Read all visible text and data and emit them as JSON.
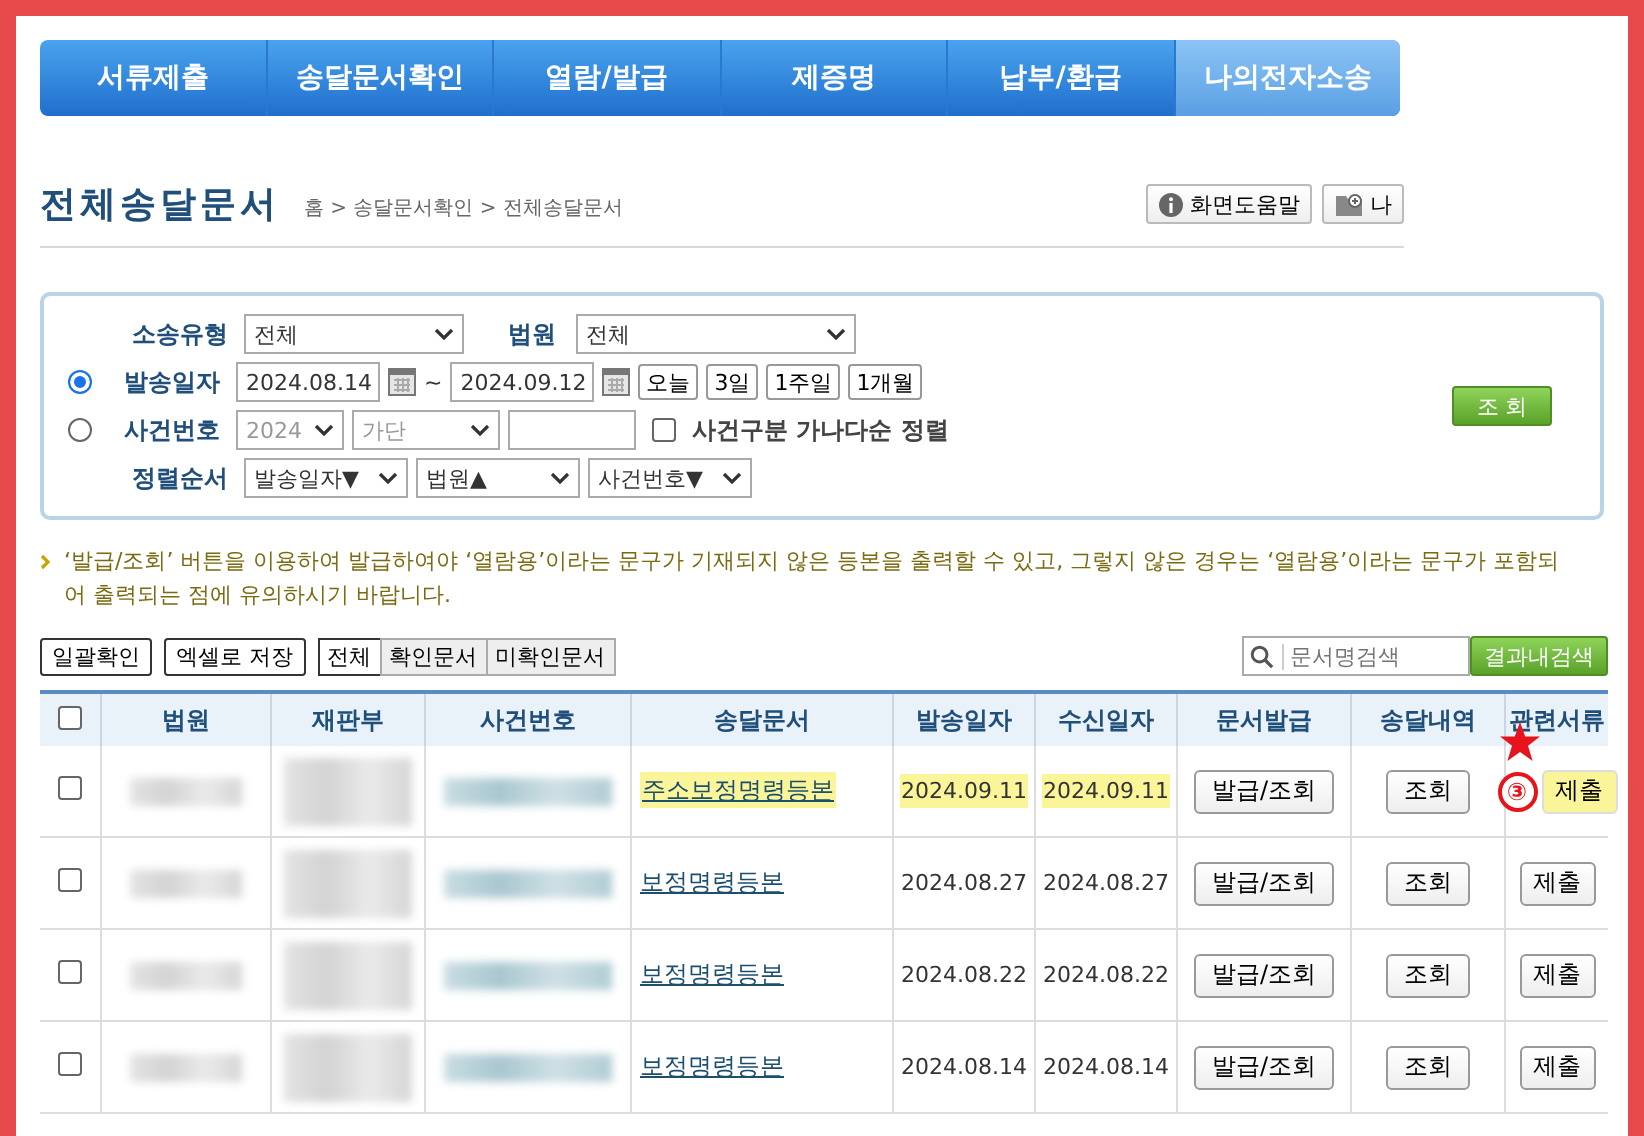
{
  "nav": [
    {
      "label": "서류제출",
      "selected": false
    },
    {
      "label": "송달문서확인",
      "selected": false
    },
    {
      "label": "열람/발급",
      "selected": false
    },
    {
      "label": "제증명",
      "selected": false
    },
    {
      "label": "납부/환급",
      "selected": false
    },
    {
      "label": "나의전자소송",
      "selected": true
    }
  ],
  "page_title": "전체송달문서",
  "breadcrumb": "홈 > 송달문서확인 > 전체송달문서",
  "header_buttons": [
    {
      "kind": "info",
      "label": "화면도움말"
    },
    {
      "kind": "folder",
      "label": "나"
    }
  ],
  "search": {
    "type_label": "소송유형",
    "type_value": "전체",
    "court_label": "법원",
    "court_value": "전체",
    "modes": [
      {
        "label": "발송일자",
        "selected": true
      },
      {
        "label": "사건번호",
        "selected": false
      }
    ],
    "date_from": "2024.08.14",
    "tilde": "~",
    "date_to": "2024.09.12",
    "quick": [
      "오늘",
      "3일",
      "1주일",
      "1개월"
    ],
    "year": {
      "value": "2024",
      "disabled": true
    },
    "case_type": {
      "value": "가단",
      "disabled": true
    },
    "sort_check": {
      "label": "사건구분 가나다순 정렬",
      "checked": false
    },
    "sort_label": "정렬순서",
    "sorts": [
      "발송일자▼",
      "법원▲",
      "사건번호▼"
    ],
    "submit": "조 회"
  },
  "notice": "‘발급/조회’ 버튼을 이용하여 발급하여야 ‘열람용’이라는 문구가 기재되지 않은 등본을 출력할 수 있고, 그렇지 않은 경우는 ‘열람용’이라는 문구가 포함되어 출력되는 점에 유의하시기 바랍니다.",
  "actions": [
    "일괄확인",
    "엑셀로 저장"
  ],
  "filters": [
    {
      "label": "전체",
      "selected": true
    },
    {
      "label": "확인문서",
      "selected": false
    },
    {
      "label": "미확인문서",
      "selected": false
    }
  ],
  "doc_search": {
    "placeholder": "문서명검색",
    "button": "결과내검색"
  },
  "table": {
    "select_all": false,
    "columns": [
      "법원",
      "재판부",
      "사건번호",
      "송달문서",
      "발송일자",
      "수신일자",
      "문서발급",
      "송달내역",
      "관련서류"
    ],
    "rows": [
      {
        "checked": false,
        "redacted": true,
        "highlighted": true,
        "document": "주소보정명령등본",
        "sent": "2024.09.11",
        "received": "2024.09.11",
        "issue": "발급/조회",
        "history": "조회",
        "related": "제출"
      },
      {
        "checked": false,
        "redacted": true,
        "highlighted": false,
        "document": "보정명령등본",
        "sent": "2024.08.27",
        "received": "2024.08.27",
        "issue": "발급/조회",
        "history": "조회",
        "related": "제출"
      },
      {
        "checked": false,
        "redacted": true,
        "highlighted": false,
        "document": "보정명령등본",
        "sent": "2024.08.22",
        "received": "2024.08.22",
        "issue": "발급/조회",
        "history": "조회",
        "related": "제출"
      },
      {
        "checked": false,
        "redacted": true,
        "highlighted": false,
        "document": "보정명령등본",
        "sent": "2024.08.14",
        "received": "2024.08.14",
        "issue": "발급/조회",
        "history": "조회",
        "related": "제출"
      }
    ]
  },
  "annotation": {
    "label": "③"
  }
}
